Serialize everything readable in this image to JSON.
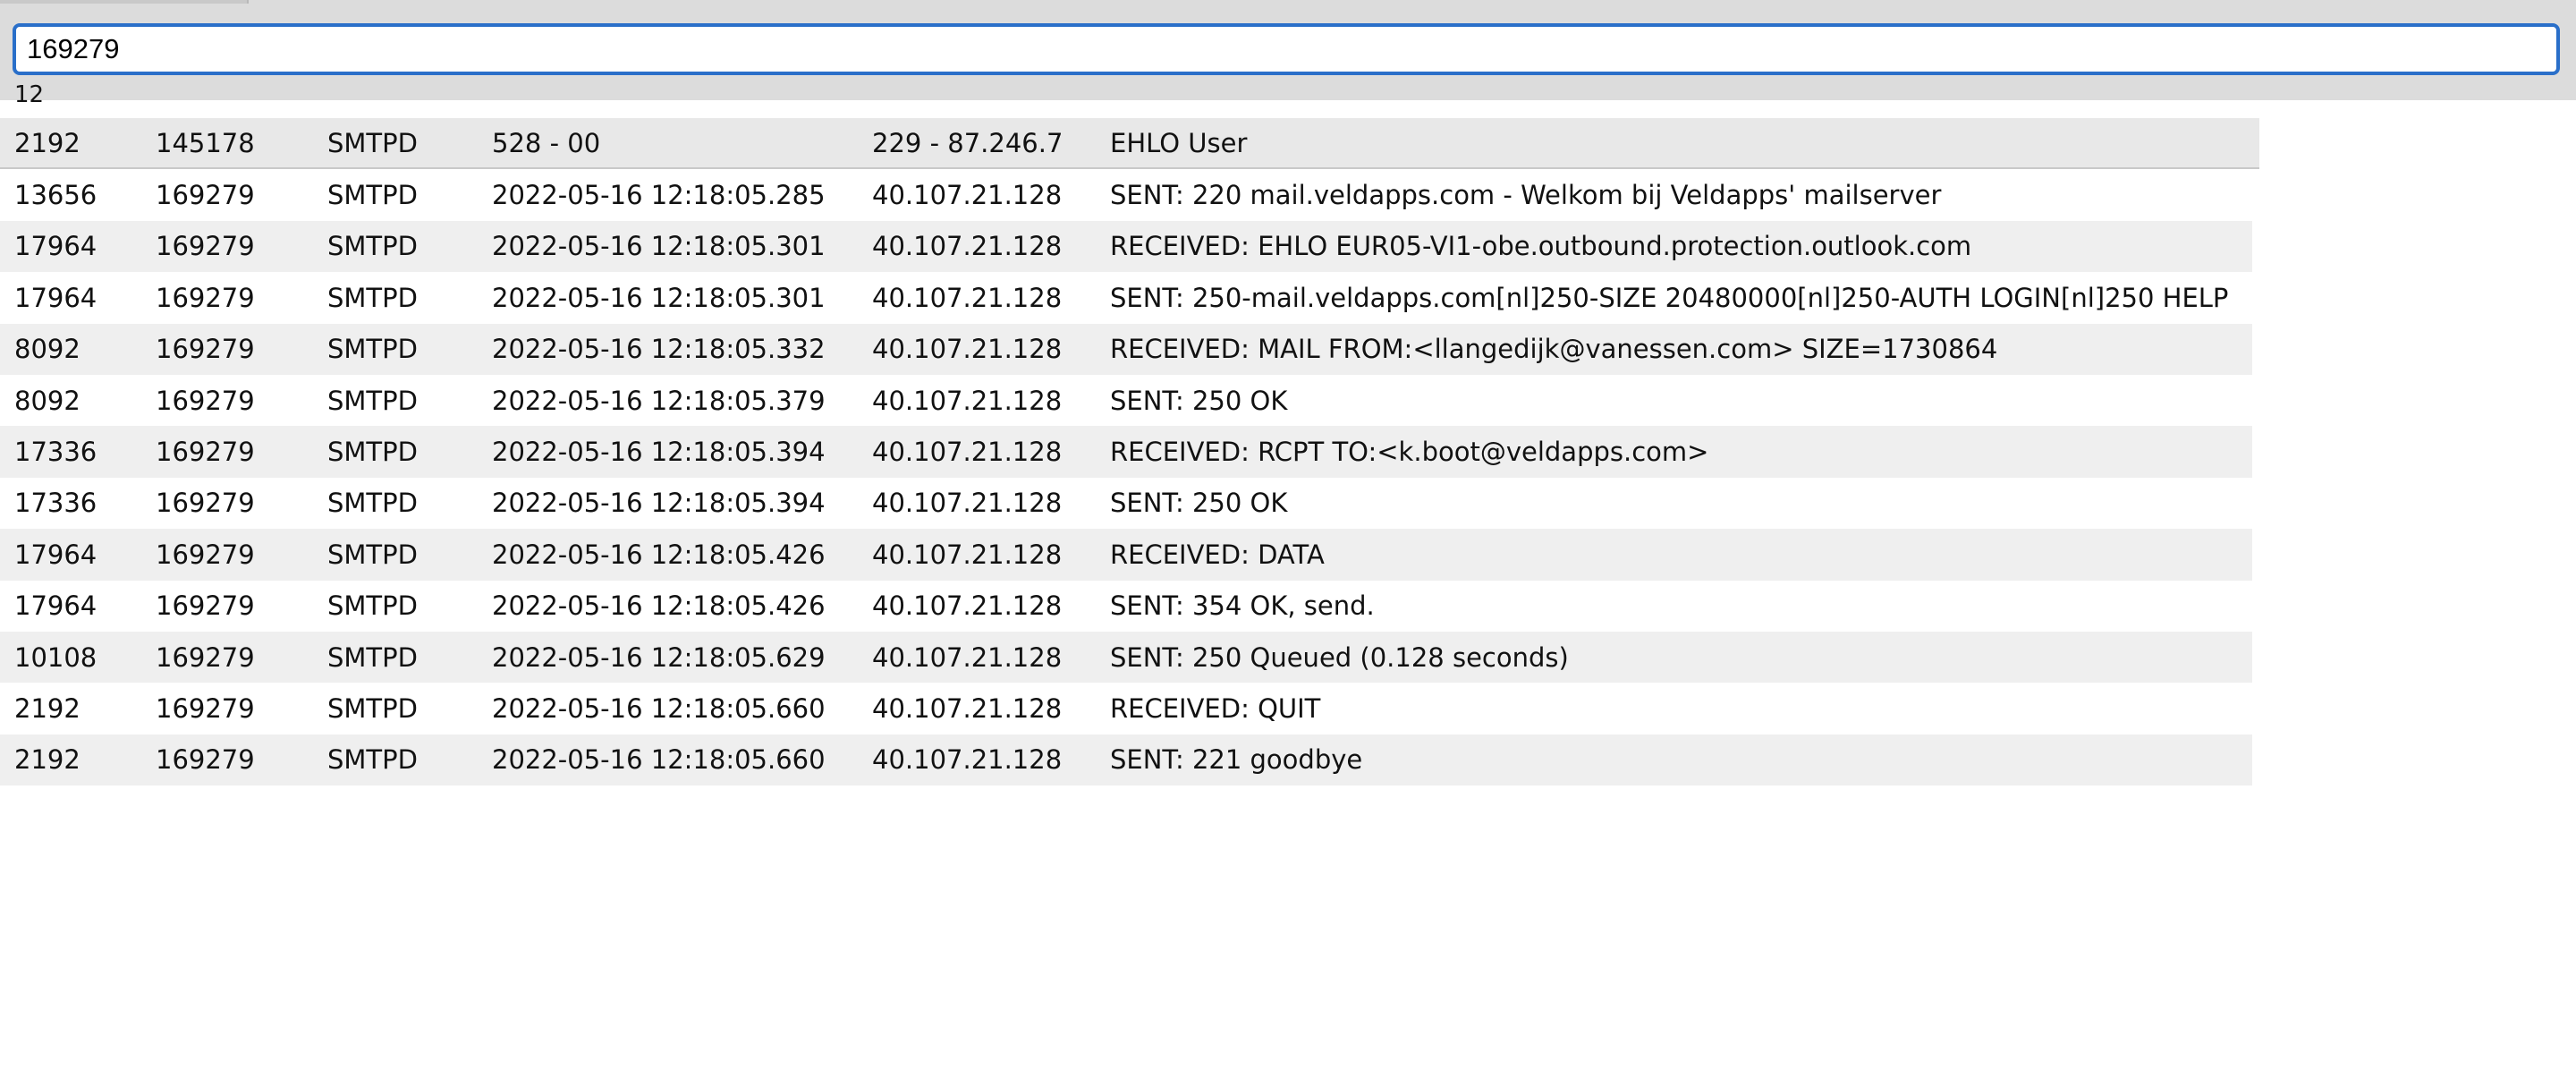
{
  "search": {
    "value": "169279"
  },
  "result_count": "12",
  "header_row": {
    "pid": "2192",
    "session": "145178",
    "type": "SMTPD",
    "time": "528 - 00",
    "ip": "229 - 87.246.7",
    "message": "EHLO User"
  },
  "rows": [
    {
      "pid": "13656",
      "session": "169279",
      "type": "SMTPD",
      "time": "2022-05-16 12:18:05.285",
      "ip": "40.107.21.128",
      "message": "SENT: 220 mail.veldapps.com - Welkom bij Veldapps' mailserver"
    },
    {
      "pid": "17964",
      "session": "169279",
      "type": "SMTPD",
      "time": "2022-05-16 12:18:05.301",
      "ip": "40.107.21.128",
      "message": "RECEIVED: EHLO EUR05-VI1-obe.outbound.protection.outlook.com"
    },
    {
      "pid": "17964",
      "session": "169279",
      "type": "SMTPD",
      "time": "2022-05-16 12:18:05.301",
      "ip": "40.107.21.128",
      "message": "SENT: 250-mail.veldapps.com[nl]250-SIZE 20480000[nl]250-AUTH LOGIN[nl]250 HELP"
    },
    {
      "pid": "8092",
      "session": "169279",
      "type": "SMTPD",
      "time": "2022-05-16 12:18:05.332",
      "ip": "40.107.21.128",
      "message": "RECEIVED: MAIL FROM:<llangedijk@vanessen.com> SIZE=1730864"
    },
    {
      "pid": "8092",
      "session": "169279",
      "type": "SMTPD",
      "time": "2022-05-16 12:18:05.379",
      "ip": "40.107.21.128",
      "message": "SENT: 250 OK"
    },
    {
      "pid": "17336",
      "session": "169279",
      "type": "SMTPD",
      "time": "2022-05-16 12:18:05.394",
      "ip": "40.107.21.128",
      "message": "RECEIVED: RCPT TO:<k.boot@veldapps.com>"
    },
    {
      "pid": "17336",
      "session": "169279",
      "type": "SMTPD",
      "time": "2022-05-16 12:18:05.394",
      "ip": "40.107.21.128",
      "message": "SENT: 250 OK"
    },
    {
      "pid": "17964",
      "session": "169279",
      "type": "SMTPD",
      "time": "2022-05-16 12:18:05.426",
      "ip": "40.107.21.128",
      "message": "RECEIVED: DATA"
    },
    {
      "pid": "17964",
      "session": "169279",
      "type": "SMTPD",
      "time": "2022-05-16 12:18:05.426",
      "ip": "40.107.21.128",
      "message": "SENT: 354 OK, send."
    },
    {
      "pid": "10108",
      "session": "169279",
      "type": "SMTPD",
      "time": "2022-05-16 12:18:05.629",
      "ip": "40.107.21.128",
      "message": "SENT: 250 Queued (0.128 seconds)"
    },
    {
      "pid": "2192",
      "session": "169279",
      "type": "SMTPD",
      "time": "2022-05-16 12:18:05.660",
      "ip": "40.107.21.128",
      "message": "RECEIVED: QUIT"
    },
    {
      "pid": "2192",
      "session": "169279",
      "type": "SMTPD",
      "time": "2022-05-16 12:18:05.660",
      "ip": "40.107.21.128",
      "message": "SENT: 221 goodbye"
    }
  ],
  "colors": {
    "focus_border": "#2a6fc9",
    "toolbar_bg": "#dcdcdc",
    "row_stripe": "#efefef"
  }
}
